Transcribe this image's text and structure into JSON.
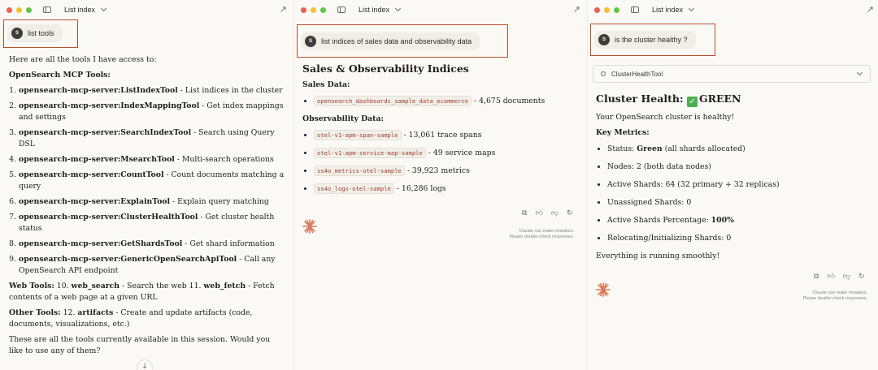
{
  "window_title": "List index",
  "panel1": {
    "avatar": "S",
    "user_message": "list tools",
    "intro": "Here are all the tools I have access to:",
    "mcp_heading": "OpenSearch MCP Tools:",
    "tools": [
      {
        "name": "opensearch-mcp-server:ListIndexTool",
        "desc": " - List indices in the cluster"
      },
      {
        "name": "opensearch-mcp-server:IndexMappingTool",
        "desc": " - Get index mappings and settings"
      },
      {
        "name": "opensearch-mcp-server:SearchIndexTool",
        "desc": " - Search using Query DSL"
      },
      {
        "name": "opensearch-mcp-server:MsearchTool",
        "desc": " - Multi-search operations"
      },
      {
        "name": "opensearch-mcp-server:CountTool",
        "desc": " - Count documents matching a query"
      },
      {
        "name": "opensearch-mcp-server:ExplainTool",
        "desc": " - Explain query matching"
      },
      {
        "name": "opensearch-mcp-server:ClusterHealthTool",
        "desc": " - Get cluster health status"
      },
      {
        "name": "opensearch-mcp-server:GetShardsTool",
        "desc": " - Get shard information"
      },
      {
        "name": "opensearch-mcp-server:GenericOpenSearchApiTool",
        "desc": " - Call any OpenSearch API endpoint"
      }
    ],
    "web_label": "Web Tools:",
    "web_num1": " 10. ",
    "web_search": "web_search",
    "web_mid": " - Search the web 11. ",
    "web_fetch": "web_fetch",
    "web_end": " - Fetch contents of a web page at a given URL",
    "other_label": "Other Tools:",
    "other_num": " 12. ",
    "artifacts": "artifacts",
    "other_end": " - Create and update artifacts (code, documents, visualizations, etc.)",
    "outro": "These are all the tools currently available in this session. Would you like to use any of them?",
    "scroll_icon": "arrow-down-icon",
    "scroll_glyph": "↓"
  },
  "panel2": {
    "avatar": "S",
    "user_message": "list indices of sales data and observability data",
    "heading": "Sales & Observability Indices",
    "sales_label": "Sales Data:",
    "sales": [
      {
        "index": "opensearch_dashboards_sample_data_ecommerce",
        "info": " - 4,675 documents"
      }
    ],
    "obs_label": "Observability Data:",
    "obs": [
      {
        "index": "otel-v1-apm-span-sample",
        "info": " - 13,061 trace spans"
      },
      {
        "index": "otel-v1-apm-service-map-sample",
        "info": " - 49 service maps"
      },
      {
        "index": "ss4o_metrics-otel-sample",
        "info": " - 39,923 metrics"
      },
      {
        "index": "ss4o_logs-otel-sample",
        "info": " - 16,286 logs"
      }
    ],
    "disclaimer1": "Claude can make mistakes.",
    "disclaimer2": "Please double-check responses."
  },
  "panel3": {
    "avatar": "S",
    "user_message": "is the cluster healthy ?",
    "tool_name": "ClusterHealthTool",
    "heading_prefix": "Cluster Health: ",
    "heading_status": "GREEN",
    "summary": "Your OpenSearch cluster is healthy!",
    "metrics_label": "Key Metrics:",
    "m_status_label": "Status: ",
    "m_status_value": "Green",
    "m_status_rest": " (all shards allocated)",
    "m_nodes": "Nodes: 2 (both data nodes)",
    "m_active": "Active Shards: 64 (32 primary + 32 replicas)",
    "m_unassigned": "Unassigned Shards: 0",
    "m_pct_label": "Active Shards Percentage: ",
    "m_pct_value": "100%",
    "m_reloc": "Relocating/Initializing Shards: 0",
    "closing": "Everything is running smoothly!",
    "disclaimer1": "Claude can make mistakes.",
    "disclaimer2": "Please double-check responses."
  },
  "colors": {
    "highlight_border": "#b5512e",
    "code_text": "#a13e2a",
    "claude_spark": "#d97757",
    "status_green": "#4caf50"
  },
  "icons": [
    "sidebar-toggle-icon",
    "chevron-down-icon",
    "share-icon",
    "copy-icon",
    "thumbs-up-icon",
    "thumbs-down-icon",
    "retry-icon",
    "claude-spark-icon",
    "tool-icon",
    "check-icon"
  ]
}
